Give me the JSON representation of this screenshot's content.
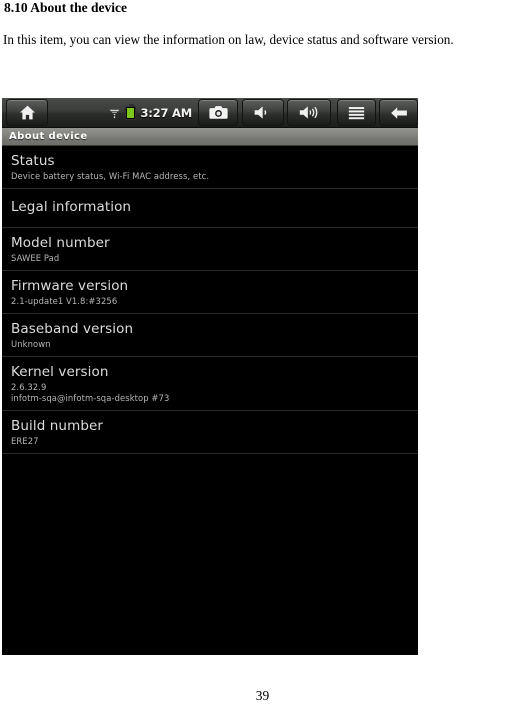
{
  "document": {
    "heading": "8.10 About the device",
    "paragraph": "In this item, you can view the information on law, device status and software version.",
    "page_number": "39"
  },
  "device_screenshot": {
    "system_bar": {
      "home_icon": "home-icon",
      "wifi_icon": "wifi-icon",
      "battery_icon": "battery-icon",
      "battery_color": "#7ec81e",
      "clock": "3:27 AM",
      "camera_icon": "camera-icon",
      "volume_down_icon": "volume-down-icon",
      "volume_up_icon": "volume-up-icon",
      "menu_icon": "menu-icon",
      "back_icon": "back-arrow-icon"
    },
    "title_bar": {
      "title": "About device"
    },
    "list": [
      {
        "title": "Status",
        "subtitle": "Device battery status, Wi-Fi MAC address, etc.",
        "subtitle2": ""
      },
      {
        "title": "Legal information",
        "subtitle": "",
        "subtitle2": ""
      },
      {
        "title": "Model number",
        "subtitle": "SAWEE Pad",
        "subtitle2": ""
      },
      {
        "title": "Firmware version",
        "subtitle": "2.1-update1 V1.8:#3256",
        "subtitle2": ""
      },
      {
        "title": "Baseband version",
        "subtitle": "Unknown",
        "subtitle2": ""
      },
      {
        "title": "Kernel version",
        "subtitle": "2.6.32.9",
        "subtitle2": "infotm-sqa@infotm-sqa-desktop #73"
      },
      {
        "title": "Build number",
        "subtitle": "ERE27",
        "subtitle2": ""
      }
    ]
  }
}
